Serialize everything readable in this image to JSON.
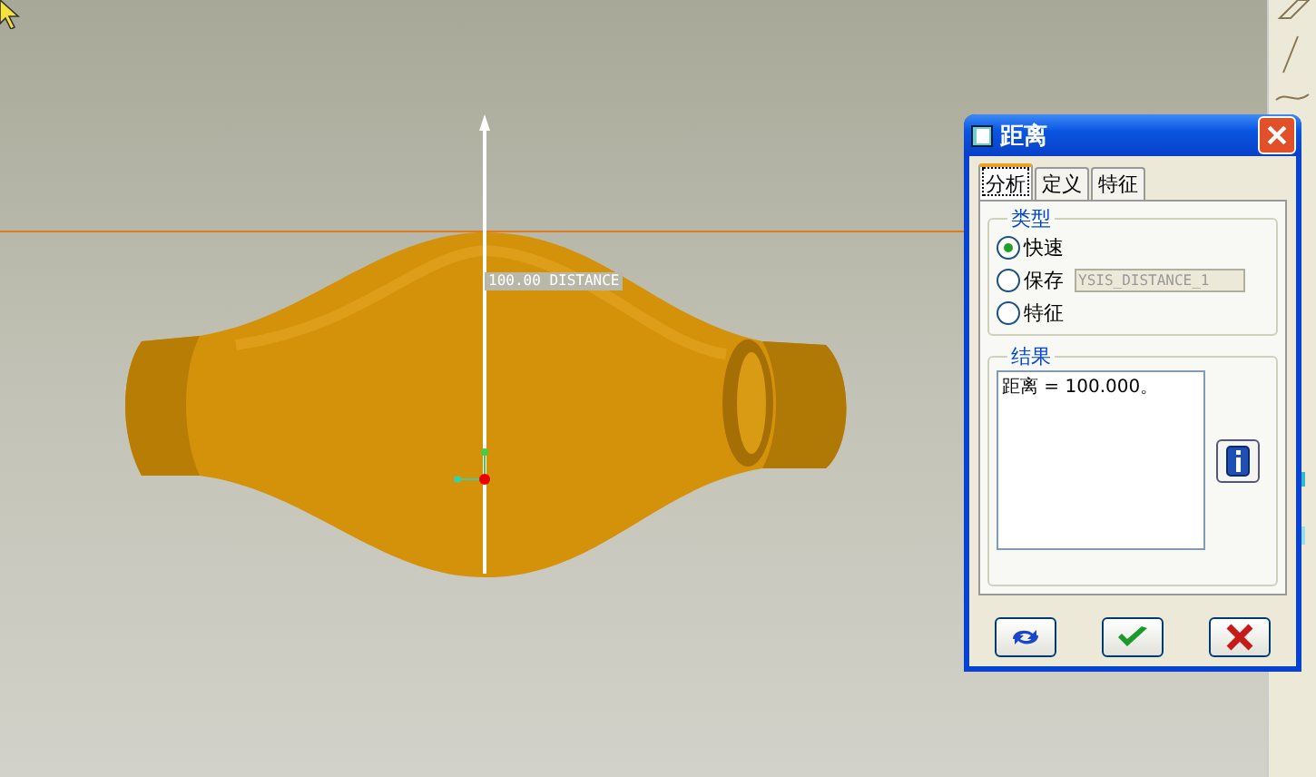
{
  "viewport": {
    "dimension_label": "100.00  DISTANCE"
  },
  "dialog": {
    "title": "距离",
    "tabs": [
      {
        "label": "分析",
        "selected": true
      },
      {
        "label": "定义",
        "selected": false
      },
      {
        "label": "特征",
        "selected": false
      }
    ],
    "type_group": {
      "title": "类型",
      "options": [
        {
          "label": "快速",
          "selected": true
        },
        {
          "label": "保存",
          "selected": false
        },
        {
          "label": "特征",
          "selected": false
        }
      ],
      "name_field": {
        "value": "YSIS_DISTANCE_1",
        "disabled": true
      }
    },
    "result_group": {
      "title": "结果",
      "text": "距离 = 100.000。"
    }
  }
}
